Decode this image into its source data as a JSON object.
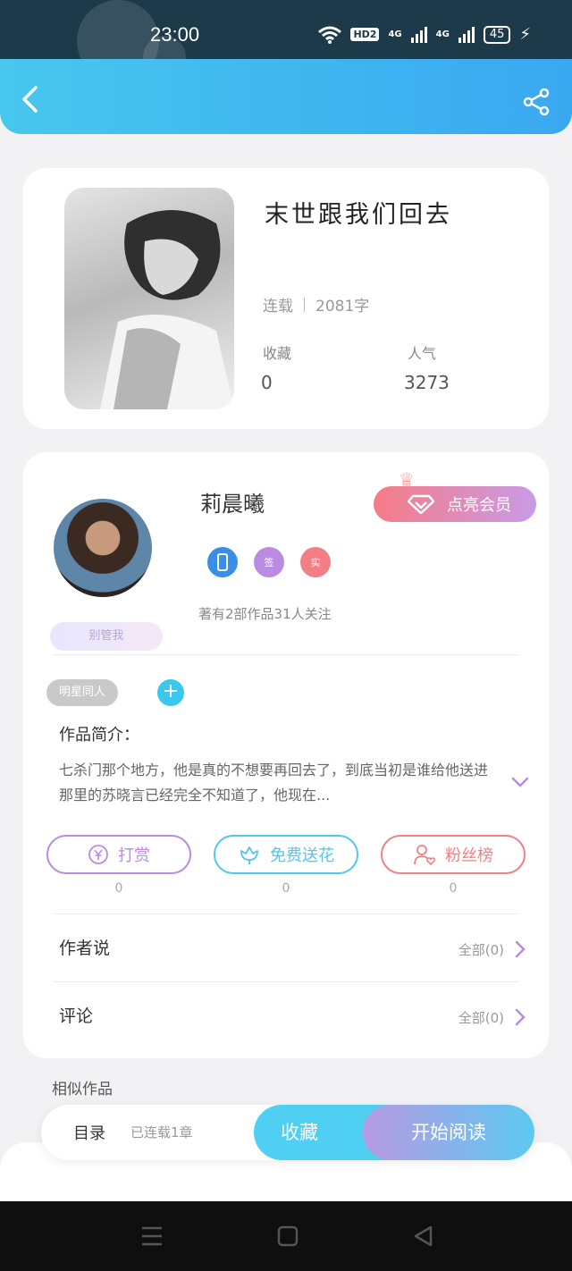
{
  "status_bar": {
    "time": "23:00",
    "hd": "HD2",
    "net1": "4G",
    "net2": "4G",
    "battery": "45"
  },
  "header": {
    "back_icon": "chevron-left-icon",
    "share_icon": "share-icon"
  },
  "book": {
    "title": "末世跟我们回去",
    "status": "连载",
    "word_count": "2081字",
    "fav_label": "收藏",
    "fav_value": "0",
    "pop_label": "人气",
    "pop_value": "3273"
  },
  "author": {
    "name": "莉晨曦",
    "vip_button": "点亮会员",
    "badges": [
      "签",
      "实"
    ],
    "works_line": "著有2部作品31人关注",
    "nickname_tag": "别管我",
    "tag": "明星同人",
    "intro_label": "作品简介：",
    "intro_text": "七杀门那个地方，他是真的不想要再回去了，到底当初是谁给他送进那里的苏晓言已经完全不知道了，他现在..."
  },
  "actions": [
    {
      "label": "打赏",
      "count": "0",
      "color": "#b98be3"
    },
    {
      "label": "免费送花",
      "count": "0",
      "color": "#4fc8ee"
    },
    {
      "label": "粉丝榜",
      "count": "0",
      "color": "#f27f85"
    }
  ],
  "rows": [
    {
      "label": "作者说",
      "value": "全部(0)"
    },
    {
      "label": "评论",
      "value": "全部(0)"
    }
  ],
  "similar_title": "相似作品",
  "bottom_bar": {
    "catalog_label": "目录",
    "catalog_status": "已连载1章",
    "fav_button": "收藏",
    "read_button": "开始阅读"
  },
  "colors": {
    "accent": "#3aa8f0",
    "vip_start": "#f67b86",
    "vip_end": "#c99be6"
  }
}
